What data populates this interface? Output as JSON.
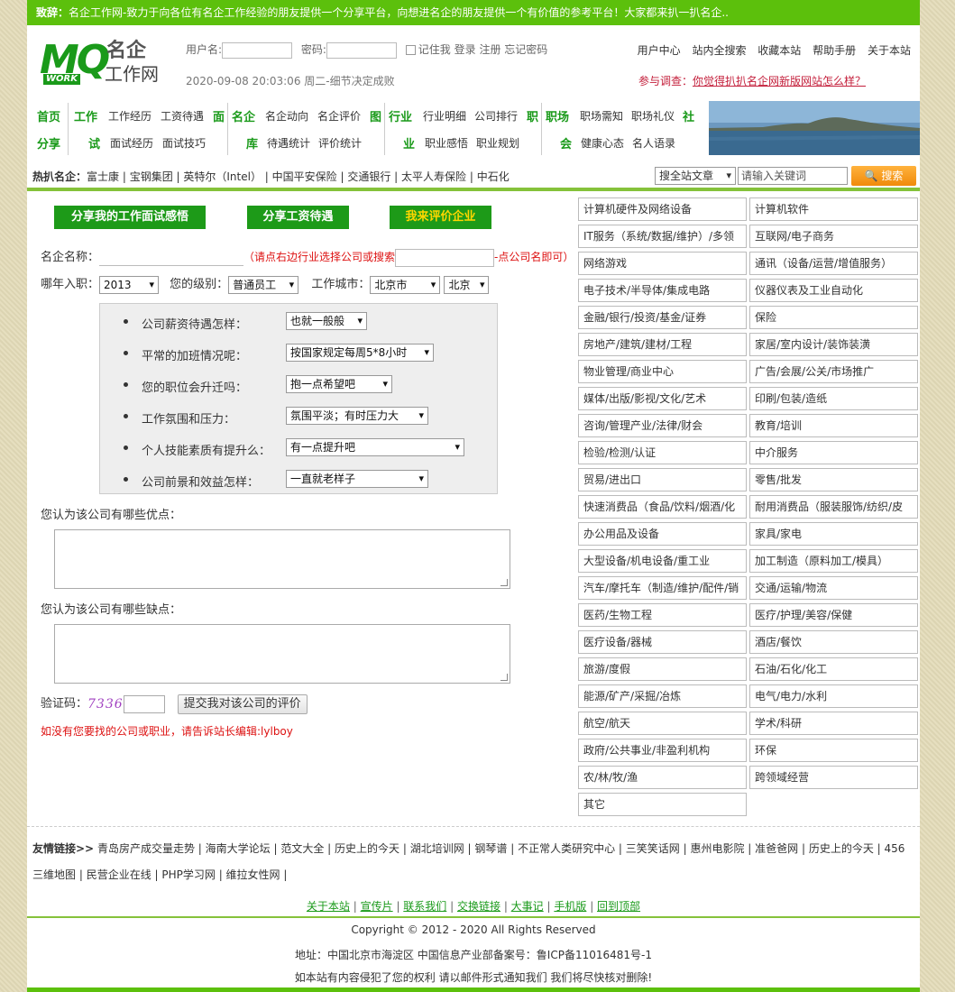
{
  "topbar": {
    "lead": "致辞：",
    "text": "名企工作网-致力于向各位有名企工作经验的朋友提供一个分享平台，向想进名企的朋友提供一个有价值的参考平台！大家都来扒一扒名企.."
  },
  "logo": {
    "mq": "MQ",
    "work": "WORK",
    "cn1": "名企",
    "cn2": "工作网"
  },
  "login": {
    "user_label": "用户名:",
    "pass_label": "密码:",
    "remember": "记住我",
    "login": "登录",
    "register": "注册",
    "forgot": "忘记密码"
  },
  "datetime": "2020-09-08 20:03:06 周二-细节决定成败",
  "toplinks": [
    "用户中心",
    "站内全搜索",
    "收藏本站",
    "帮助手册",
    "关于本站"
  ],
  "survey": {
    "label": "参与调查：",
    "link": "你觉得扒扒名企网新版网站怎么样？"
  },
  "nav": {
    "g1": {
      "l1": "首页",
      "l2": "分享"
    },
    "g2": {
      "l1": "工作",
      "l2": "试",
      "a1": "工作经历",
      "a2": "工资待遇",
      "a3": "面试经历",
      "a4": "面试技巧",
      "r1": "面"
    },
    "g3": {
      "l1": "名企",
      "l2": "库",
      "a1": "名企动向",
      "a2": "名企评价",
      "a3": "待遇统计",
      "a4": "评价统计",
      "r1": "图"
    },
    "g4": {
      "l1": "行业",
      "l2": "业",
      "a1": "行业明细",
      "a2": "公司排行",
      "a3": "职业感悟",
      "a4": "职业规划",
      "r1": "职"
    },
    "g5": {
      "l1": "职场",
      "l2": "会",
      "a1": "职场需知",
      "a2": "职场礼仪",
      "a3": "健康心态",
      "a4": "名人语录",
      "r1": "社"
    }
  },
  "hot": {
    "label": "热扒名企：",
    "items": [
      "富士康",
      "宝钢集团",
      "英特尔（Intel）",
      "中国平安保险",
      "交通银行",
      "太平人寿保险",
      "中石化"
    ]
  },
  "search": {
    "scope": "搜全站文章",
    "placeholder": "请输入关键词",
    "button": "搜索"
  },
  "tabs": [
    "分享我的工作面试感悟",
    "分享工资待遇",
    "我来评价企业"
  ],
  "form": {
    "company_label": "名企名称：",
    "company_hint1": "（请点右边行业选择公司或搜索",
    "company_hint2": "-点公司名即可）",
    "year_label": "哪年入职：",
    "year": "2013",
    "level_label": "您的级别：",
    "level": "普通员工",
    "city_label": "工作城市：",
    "province": "北京市",
    "city": "北京",
    "questions": [
      {
        "q": "公司薪资待遇怎样：",
        "a": "也就一般般"
      },
      {
        "q": "平常的加班情况呢：",
        "a": "按国家规定每周5*8小时"
      },
      {
        "q": "您的职位会升迁吗：",
        "a": "抱一点希望吧"
      },
      {
        "q": "工作氛围和压力：",
        "a": "氛围平淡；有时压力大"
      },
      {
        "q": "个人技能素质有提升么：",
        "a": "有一点提升吧"
      },
      {
        "q": "公司前景和效益怎样：",
        "a": "一直就老样子"
      }
    ],
    "pros_label": "您认为该公司有哪些优点：",
    "cons_label": "您认为该公司有哪些缺点：",
    "captcha_label": "验证码：",
    "captcha": "7336",
    "submit": "提交我对该公司的评价",
    "notice": "如没有您要找的公司或职业，请告诉站长编辑:lylboy"
  },
  "industries": [
    "计算机硬件及网络设备",
    "计算机软件",
    "IT服务（系统/数据/维护）/多领",
    "互联网/电子商务",
    "网络游戏",
    "通讯（设备/运营/增值服务）",
    "电子技术/半导体/集成电路",
    "仪器仪表及工业自动化",
    "金融/银行/投资/基金/证券",
    "保险",
    "房地产/建筑/建材/工程",
    "家居/室内设计/装饰装潢",
    "物业管理/商业中心",
    "广告/会展/公关/市场推广",
    "媒体/出版/影视/文化/艺术",
    "印刷/包装/造纸",
    "咨询/管理产业/法律/财会",
    "教育/培训",
    "检验/检测/认证",
    "中介服务",
    "贸易/进出口",
    "零售/批发",
    "快速消费品（食品/饮料/烟酒/化",
    "耐用消费品（服装服饰/纺织/皮",
    "办公用品及设备",
    "家具/家电",
    "大型设备/机电设备/重工业",
    "加工制造（原料加工/模具）",
    "汽车/摩托车（制造/维护/配件/销",
    "交通/运输/物流",
    "医药/生物工程",
    "医疗/护理/美容/保健",
    "医疗设备/器械",
    "酒店/餐饮",
    "旅游/度假",
    "石油/石化/化工",
    "能源/矿产/采掘/冶炼",
    "电气/电力/水利",
    "航空/航天",
    "学术/科研",
    "政府/公共事业/非盈利机构",
    "环保",
    "农/林/牧/渔",
    "跨领域经营",
    "其它"
  ],
  "friends": {
    "label": "友情链接>>",
    "items": [
      "青岛房产成交量走势",
      "海南大学论坛",
      "范文大全",
      "历史上的今天",
      "湖北培训网",
      "钢琴谱",
      "不正常人类研究中心",
      "三笑笑话网",
      "惠州电影院",
      "准爸爸网",
      "历史上的今天",
      "456三维地图",
      "民营企业在线",
      "PHP学习网",
      "维拉女性网"
    ]
  },
  "footnav": [
    "关于本站",
    "宣传片",
    "联系我们",
    "交换链接",
    "大事记",
    "手机版",
    "回到顶部"
  ],
  "footer": {
    "copyright": "Copyright © 2012 - 2020 All Rights Reserved",
    "address": "地址：中国北京市海淀区 中国信息产业部备案号：鲁ICP备11016481号-1",
    "notice": "如本站有内容侵犯了您的权利 请以邮件形式通知我们 我们将尽快核对删除!"
  }
}
